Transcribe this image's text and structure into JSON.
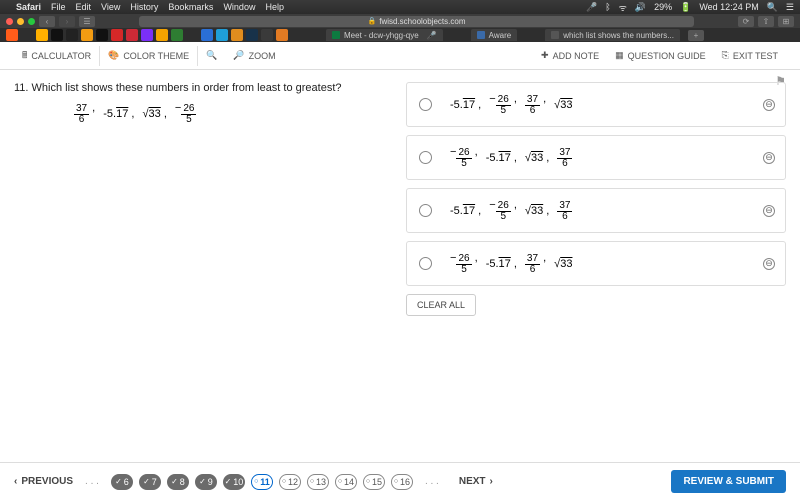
{
  "menubar": {
    "app": "Safari",
    "items": [
      "File",
      "Edit",
      "View",
      "History",
      "Bookmarks",
      "Window",
      "Help"
    ],
    "battery": "29%",
    "clock": "Wed 12:24 PM"
  },
  "browser": {
    "url": "fwisd.schoolobjects.com",
    "tabs": [
      {
        "label": "Meet - dcw-yhgg-qye",
        "color": "#0d7a40"
      },
      {
        "label": "Aware",
        "color": "#3a6aa8"
      },
      {
        "label": "which list shows the numbers...",
        "color": "#555"
      }
    ]
  },
  "bookmarks_colors": [
    "#ff5c1a",
    "#2e2e2e",
    "#ffb000",
    "#111",
    "#222",
    "#f39c12",
    "#111",
    "#d62828",
    "#cc2a36",
    "#7b2ff7",
    "#f4a300",
    "#2e7d32",
    "#2e2e2e",
    "#2a6fd6",
    "#1f9ed8",
    "#e08d1e",
    "#18324a",
    "#3a3a3a",
    "#e37b23"
  ],
  "toolbar": {
    "calculator": "CALCULATOR",
    "theme": "COLOR THEME",
    "zoom": "ZOOM",
    "addnote": "ADD NOTE",
    "guide": "QUESTION GUIDE",
    "exit": "EXIT TEST"
  },
  "question": {
    "number": "11.",
    "text": "Which list shows these numbers in order from least to greatest?",
    "given": [
      "37/6",
      "-5.17r",
      "s33",
      "-26/5"
    ]
  },
  "choices": [
    [
      "-5.17r",
      "-26/5",
      "37/6",
      "s33"
    ],
    [
      "-26/5",
      "-5.17r",
      "s33",
      "37/6"
    ],
    [
      "-5.17r",
      "-26/5",
      "s33",
      "37/6"
    ],
    [
      "-26/5",
      "-5.17r",
      "37/6",
      "s33"
    ]
  ],
  "clear": "CLEAR ALL",
  "nav": {
    "prev": "PREVIOUS",
    "next": "NEXT",
    "done": [
      "6",
      "7",
      "8",
      "9",
      "10"
    ],
    "current": "11",
    "todo": [
      "12",
      "13",
      "14",
      "15",
      "16"
    ],
    "submit": "REVIEW & SUBMIT"
  }
}
